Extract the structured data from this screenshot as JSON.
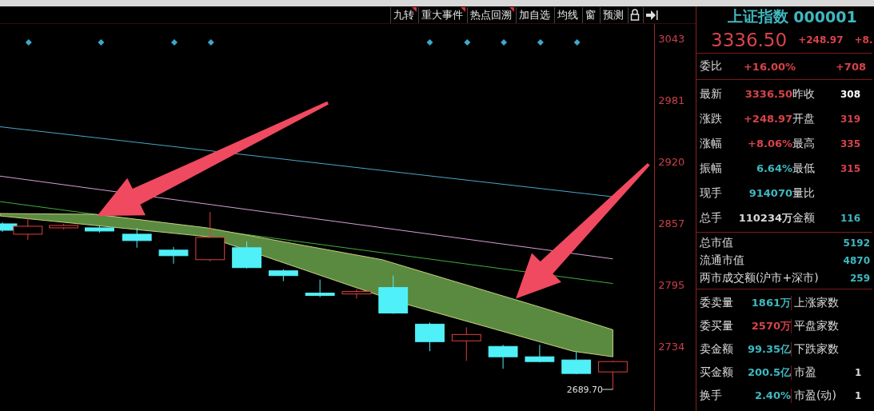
{
  "toolbar": [
    {
      "label": "九转",
      "marked": true
    },
    {
      "label": "重大事件",
      "marked": true
    },
    {
      "label": "热点回溯",
      "marked": true
    },
    {
      "label": "加自选",
      "marked": false
    },
    {
      "label": "均线",
      "marked": false
    },
    {
      "label": "窗",
      "marked": false
    },
    {
      "label": "预测",
      "marked": false
    }
  ],
  "chart": {
    "price_ticks": [
      "3043",
      "2981",
      "2920",
      "2857",
      "2795",
      "2734"
    ],
    "low_label": "2689.70"
  },
  "quote": {
    "name": "上证指数",
    "code": "000001",
    "price": "3336.50",
    "change": "+248.97",
    "change_pct": "+8."
  },
  "order_ratio": {
    "label": "委比",
    "value": "+16.00%",
    "value_2": "+708"
  },
  "stats": [
    {
      "left": {
        "label": "最新",
        "value": "3336.50",
        "color": "#d8434b"
      },
      "right": {
        "label": "昨收",
        "value": "308",
        "color": "#ffffff"
      }
    },
    {
      "left": {
        "label": "涨跌",
        "value": "+248.97",
        "color": "#d8434b"
      },
      "right": {
        "label": "开盘",
        "value": "319",
        "color": "#d8434b"
      }
    },
    {
      "left": {
        "label": "涨幅",
        "value": "+8.06%",
        "color": "#d8434b"
      },
      "right": {
        "label": "最高",
        "value": "335",
        "color": "#d8434b"
      }
    },
    {
      "left": {
        "label": "振幅",
        "value": "6.64%",
        "color": "#3fb8c0"
      },
      "right": {
        "label": "最低",
        "value": "315",
        "color": "#d8434b"
      }
    },
    {
      "left": {
        "label": "现手",
        "value": "914070",
        "color": "#3fb8c0"
      },
      "right": {
        "label": "量比"
      }
    },
    {
      "left": {
        "label": "总手",
        "value": "110234万",
        "color": "#d8d8d8"
      },
      "right": {
        "label": "金额",
        "value": "116",
        "color": "#3fb8c0"
      }
    }
  ],
  "market": [
    {
      "label": "总市值",
      "value": "5192"
    },
    {
      "label": "流通市值",
      "value": "4870"
    },
    {
      "label": "两市成交额(沪市+深市)",
      "value": "259"
    }
  ],
  "orders": [
    {
      "label": "委卖量",
      "value": "1861万",
      "color": "#3fb8c0",
      "label_2": "上涨家数"
    },
    {
      "label": "委买量",
      "value": "2570万",
      "color": "#d8434b",
      "label_2": "平盘家数"
    },
    {
      "label": "卖金额",
      "value": "99.35亿",
      "color": "#3fb8c0",
      "label_2": "下跌家数"
    },
    {
      "label": "买金额",
      "value": "200.5亿",
      "color": "#3fb8c0",
      "label_2": "市盈",
      "value_2": "1"
    },
    {
      "label": "换手",
      "value": "2.40%",
      "color": "#3fb8c0",
      "label_2": "市盈(动)",
      "value_2": "1"
    }
  ]
}
